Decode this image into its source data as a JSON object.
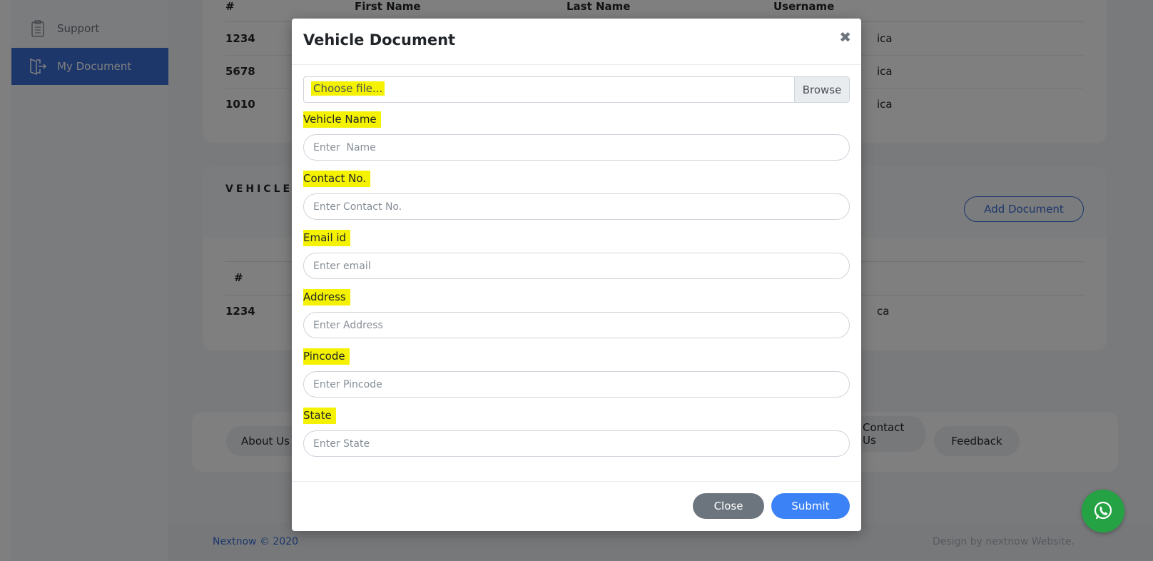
{
  "sidebar": {
    "items": [
      {
        "label": "Support",
        "icon": "clipboard-icon"
      },
      {
        "label": "My Document",
        "icon": "document-exit-icon"
      }
    ]
  },
  "table1": {
    "headers": [
      "#",
      "First Name",
      "Last Name",
      "Username"
    ],
    "rows": [
      {
        "id": "1234",
        "tail": "ica"
      },
      {
        "id": "5678",
        "tail": "ica"
      },
      {
        "id": "1010",
        "tail": "ica"
      }
    ]
  },
  "vehicle_section": {
    "title_partial": "VEHICLE D",
    "add_button": "Add Document",
    "header": "#",
    "rows": [
      {
        "id": "1234",
        "tail": "ca"
      }
    ]
  },
  "links": {
    "about": "About Us",
    "contact": "Contact Us",
    "feedback": "Feedback"
  },
  "footer": {
    "copyright": "Nextnow © 2020",
    "credit": "Design by nextnow Website."
  },
  "modal": {
    "title": "Vehicle Document",
    "close_symbol": "✖",
    "file": {
      "placeholder": "Choose file...",
      "button": "Browse"
    },
    "fields": [
      {
        "label": "Vehicle Name",
        "placeholder": "Enter  Name"
      },
      {
        "label": "Contact No.",
        "placeholder": "Enter Contact No."
      },
      {
        "label": "Email id",
        "placeholder": "Enter email"
      },
      {
        "label": "Address",
        "placeholder": "Enter Address"
      },
      {
        "label": "Pincode",
        "placeholder": "Enter Pincode"
      },
      {
        "label": "State",
        "placeholder": "Enter State"
      }
    ],
    "close_button": "Close",
    "submit_button": "Submit"
  },
  "colors": {
    "primary": "#3b6fd6",
    "highlight": "#f4f200",
    "whatsapp": "#25a244",
    "secondary": "#6c757d"
  }
}
